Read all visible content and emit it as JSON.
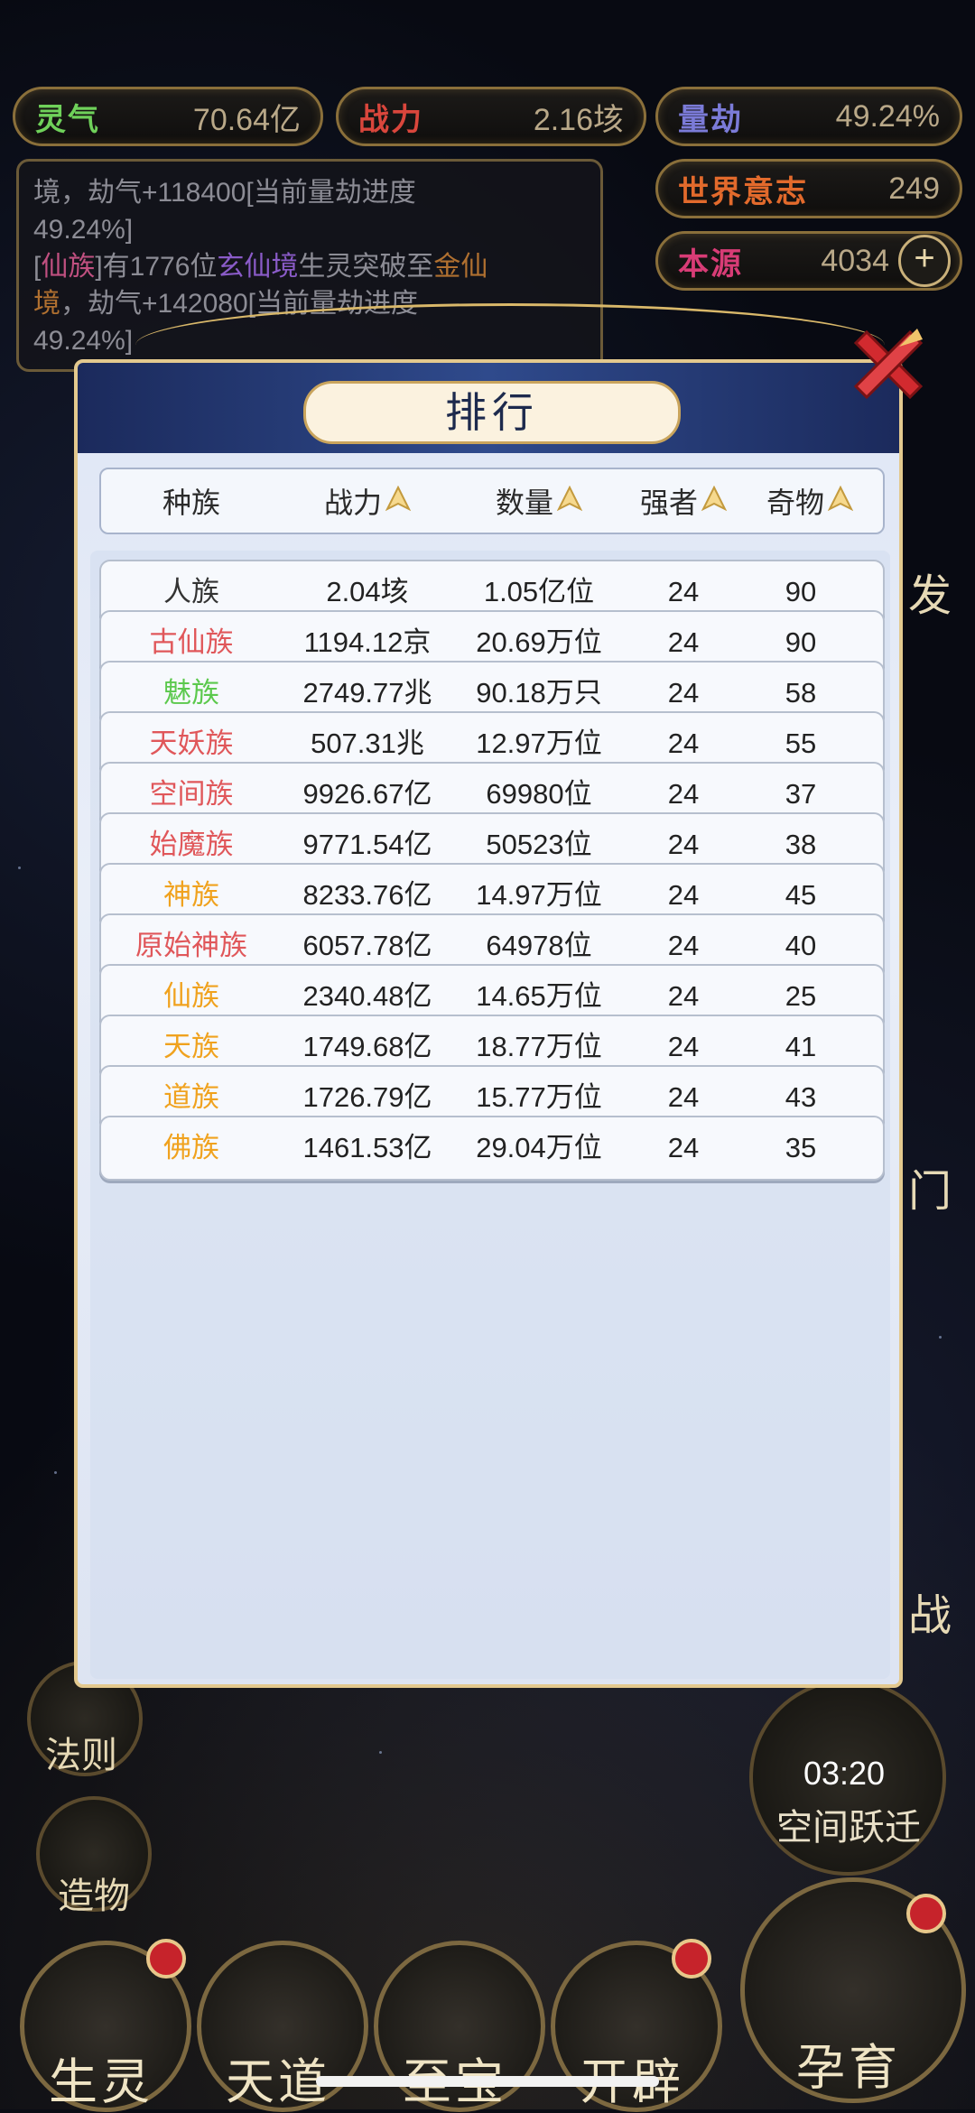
{
  "status": {
    "lingqi": {
      "label": "灵气",
      "value": "70.64亿",
      "color": "#6fd15a"
    },
    "zhanli": {
      "label": "战力",
      "value": "2.16垓",
      "color": "#d9463c"
    },
    "liangjie": {
      "label": "量劫",
      "value": "49.24%",
      "color": "#7b7bd8"
    },
    "shijie": {
      "label": "世界意志",
      "value": "249",
      "color": "#e26a2c"
    },
    "benyuan": {
      "label": "本源",
      "value": "4034",
      "color": "#d83c76",
      "plus": "+"
    }
  },
  "log": {
    "line1": "境，劫气+118400[当前量劫进度",
    "line2": "49.24%]",
    "line3_a": "[",
    "line3_b": "仙族",
    "line3_c": "]有1776位",
    "line3_d": "玄仙境",
    "line3_e": "生灵突破至",
    "line3_f": "金仙",
    "line4_a": "境",
    "line4_b": "，劫气+142080[当前量劫进度",
    "line5": "49.24%]"
  },
  "side": {
    "fa_ze": "法则",
    "zao_wu": "造物",
    "timer": "03:20",
    "kongjian": "空间跃迁",
    "fa": "发",
    "men": "门",
    "zhan": "战"
  },
  "bottom": {
    "sheng_ling": "生灵",
    "tian_dao": "天道",
    "zhi_bao": "至宝",
    "kai_pi": "开辟",
    "yun_yu": "孕育"
  },
  "modal": {
    "title": "排行",
    "headers": {
      "race": "种族",
      "power": "战力",
      "qty": "数量",
      "strong": "强者",
      "item": "奇物"
    },
    "rows": [
      {
        "race": "人族",
        "power": "2.04垓",
        "qty": "1.05亿位",
        "strong": "24",
        "item": "90",
        "color": "#333333"
      },
      {
        "race": "古仙族",
        "power": "1194.12京",
        "qty": "20.69万位",
        "strong": "24",
        "item": "90",
        "color": "#e0575a"
      },
      {
        "race": "魅族",
        "power": "2749.77兆",
        "qty": "90.18万只",
        "strong": "24",
        "item": "58",
        "color": "#5cc94d"
      },
      {
        "race": "天妖族",
        "power": "507.31兆",
        "qty": "12.97万位",
        "strong": "24",
        "item": "55",
        "color": "#e0575a"
      },
      {
        "race": "空间族",
        "power": "9926.67亿",
        "qty": "69980位",
        "strong": "24",
        "item": "37",
        "color": "#e0575a"
      },
      {
        "race": "始魔族",
        "power": "9771.54亿",
        "qty": "50523位",
        "strong": "24",
        "item": "38",
        "color": "#e0575a"
      },
      {
        "race": "神族",
        "power": "8233.76亿",
        "qty": "14.97万位",
        "strong": "24",
        "item": "45",
        "color": "#f0a21e"
      },
      {
        "race": "原始神族",
        "power": "6057.78亿",
        "qty": "64978位",
        "strong": "24",
        "item": "40",
        "color": "#e0575a"
      },
      {
        "race": "仙族",
        "power": "2340.48亿",
        "qty": "14.65万位",
        "strong": "24",
        "item": "25",
        "color": "#f0a21e"
      },
      {
        "race": "天族",
        "power": "1749.68亿",
        "qty": "18.77万位",
        "strong": "24",
        "item": "41",
        "color": "#f0a21e"
      },
      {
        "race": "道族",
        "power": "1726.79亿",
        "qty": "15.77万位",
        "strong": "24",
        "item": "43",
        "color": "#f0a21e"
      },
      {
        "race": "佛族",
        "power": "1461.53亿",
        "qty": "29.04万位",
        "strong": "24",
        "item": "35",
        "color": "#f0a21e"
      }
    ]
  }
}
